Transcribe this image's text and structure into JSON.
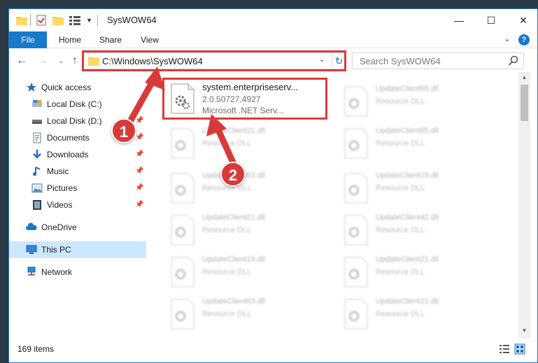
{
  "window": {
    "title": "SysWOW64",
    "controls": {
      "minimize": "—",
      "maximize": "☐",
      "close": "✕"
    }
  },
  "ribbon": {
    "tabs": [
      "File",
      "Home",
      "Share",
      "View"
    ],
    "expand_glyph": "⌄",
    "help_glyph": "?"
  },
  "nav": {
    "back_glyph": "←",
    "forward_glyph": "→",
    "recent_glyph": "⌄",
    "up_glyph": "↑",
    "address": "C:\\Windows\\SysWOW64",
    "address_drop_glyph": "⌄",
    "refresh_glyph": "↻",
    "search_placeholder": "Search SysWOW64"
  },
  "sidebar": {
    "items": [
      {
        "label": "Quick access",
        "icon": "star-icon"
      },
      {
        "label": "Local Disk (C:)",
        "icon": "drive-icon"
      },
      {
        "label": "Local Disk (D:)",
        "icon": "drive-icon"
      },
      {
        "label": "Documents",
        "icon": "documents-icon"
      },
      {
        "label": "Downloads",
        "icon": "download-icon"
      },
      {
        "label": "Music",
        "icon": "music-icon"
      },
      {
        "label": "Pictures",
        "icon": "pictures-icon"
      },
      {
        "label": "Videos",
        "icon": "videos-icon"
      },
      {
        "label": "OneDrive",
        "icon": "cloud-icon"
      },
      {
        "label": "This PC",
        "icon": "computer-icon"
      },
      {
        "label": "Network",
        "icon": "network-icon"
      }
    ],
    "selected": "This PC"
  },
  "files": {
    "highlighted": {
      "name": "system.enterpriseserv...",
      "version": "2.0.50727.4927",
      "description": "Microsoft .NET Serv..."
    },
    "left_column": [
      {
        "name": "UpdateClient21.dll",
        "type": "Resource DLL"
      },
      {
        "name": "UpdateClient63.dll",
        "type": "Resource DLL"
      },
      {
        "name": "UpdateClient21.dll",
        "type": "Resource DLL"
      },
      {
        "name": "UpdateClient19.dll",
        "type": "Resource DLL"
      },
      {
        "name": "UpdateClient63.dll",
        "type": "Resource DLL"
      }
    ],
    "right_column": [
      {
        "name": "UpdateClient65.dll",
        "type": "Resource DLL"
      },
      {
        "name": "UpdateClient65.dll",
        "type": "Resource DLL"
      },
      {
        "name": "UpdateClient19.dll",
        "type": "Resource DLL"
      },
      {
        "name": "UpdateClient42.dll",
        "type": "Resource DLL"
      },
      {
        "name": "UpdateClient21.dll",
        "type": "Resource DLL"
      },
      {
        "name": "UpdateClient21.dll",
        "type": "Resource DLL"
      }
    ]
  },
  "annotations": {
    "step1": "1",
    "step2": "2"
  },
  "status": {
    "item_count": "169 items"
  },
  "colors": {
    "accent": "#1979ca",
    "highlight": "#dc3b3b",
    "selected_bg": "#cce8ff"
  }
}
